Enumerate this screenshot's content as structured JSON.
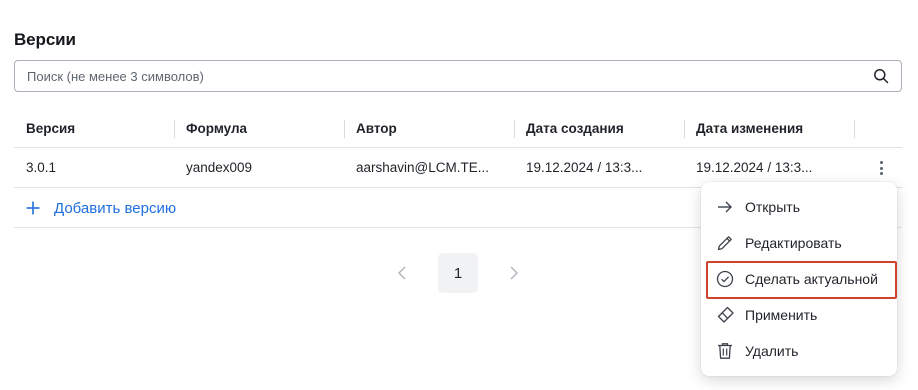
{
  "page": {
    "title": "Версии"
  },
  "search": {
    "placeholder": "Поиск (не менее 3 символов)"
  },
  "table": {
    "columns": [
      "Версия",
      "Формула",
      "Автор",
      "Дата создания",
      "Дата изменения"
    ],
    "rows": [
      {
        "version": "3.0.1",
        "formula": "yandex009",
        "author": "aarshavin@LCM.TE...",
        "created": "19.12.2024 / 13:3...",
        "modified": "19.12.2024 / 13:3..."
      }
    ]
  },
  "add_version": {
    "label": "Добавить версию"
  },
  "pagination": {
    "current_page": "1"
  },
  "context_menu": {
    "items": [
      {
        "label": "Открыть",
        "icon": "arrow-right-icon"
      },
      {
        "label": "Редактировать",
        "icon": "pencil-icon"
      },
      {
        "label": "Сделать актуальной",
        "icon": "check-circle-icon",
        "highlighted": true
      },
      {
        "label": "Применить",
        "icon": "eraser-icon"
      },
      {
        "label": "Удалить",
        "icon": "trash-icon"
      }
    ]
  },
  "colors": {
    "accent": "#1f6fe0",
    "highlight_border": "#d0432b",
    "divider": "#dfe2e6"
  }
}
